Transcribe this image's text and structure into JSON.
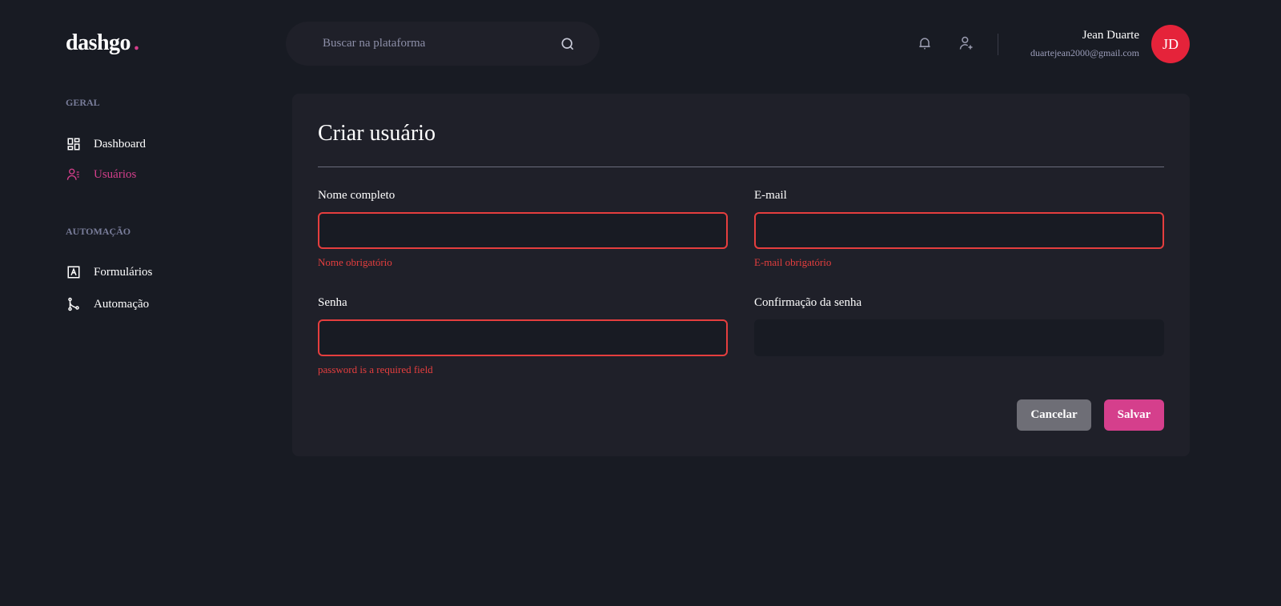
{
  "logo": {
    "text": "dashgo",
    "dot": "."
  },
  "search": {
    "placeholder": "Buscar na plataforma"
  },
  "user": {
    "name": "Jean Duarte",
    "email": "duartejean2000@gmail.com",
    "initials": "JD"
  },
  "sidebar": {
    "sections": [
      {
        "title": "GERAL",
        "items": [
          {
            "label": "Dashboard",
            "icon": "dashboard-icon"
          },
          {
            "label": "Usuários",
            "icon": "users-icon",
            "active": true
          }
        ]
      },
      {
        "title": "AUTOMAÇÃO",
        "items": [
          {
            "label": "Formulários",
            "icon": "form-icon"
          },
          {
            "label": "Automação",
            "icon": "git-branch-icon"
          }
        ]
      }
    ]
  },
  "form": {
    "title": "Criar usuário",
    "fields": [
      {
        "label": "Nome completo",
        "error": "Nome obrigatório"
      },
      {
        "label": "E-mail",
        "error": "E-mail obrigatório"
      },
      {
        "label": "Senha",
        "error": "password is a required field"
      },
      {
        "label": "Confirmação da senha",
        "error": ""
      }
    ],
    "cancel": "Cancelar",
    "save": "Salvar"
  },
  "colors": {
    "accent": "#d53f8c",
    "error": "#e53e3e",
    "avatar": "#e5233a",
    "background": "#181b23",
    "card": "#1f2029"
  }
}
